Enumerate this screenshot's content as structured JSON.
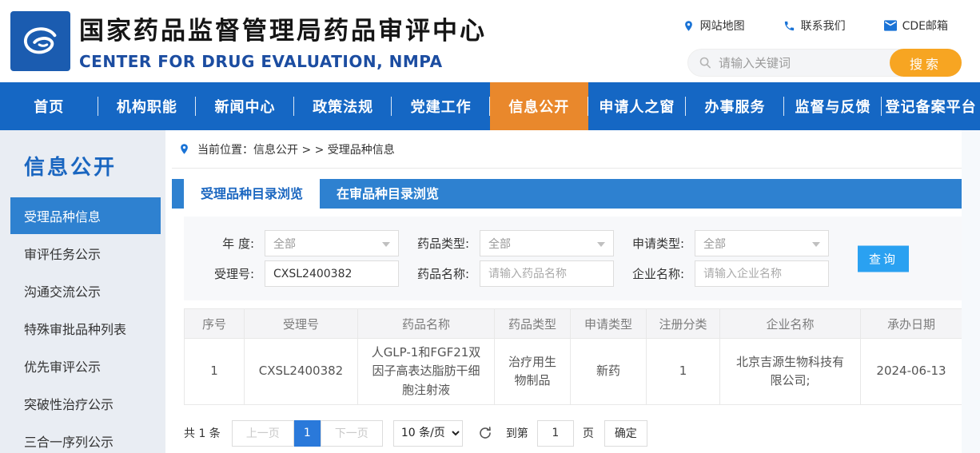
{
  "palette": {
    "nav_blue": "#1567c4",
    "tab_blue": "#2e81d0",
    "active_orange": "#e9882c",
    "search_button_orange": "#f7a522",
    "query_button_blue": "#2aa1f1",
    "pagination_active_blue": "#2a79da",
    "sidebar_bg": "#e9edf3",
    "subtitle_blue": "#1c4da1"
  },
  "header": {
    "title": "国家药品监督管理局药品审评中心",
    "subtitle": "CENTER FOR DRUG EVALUATION, NMPA",
    "quick_links": [
      {
        "label": "网站地图",
        "icon": "location-pin-icon"
      },
      {
        "label": "联系我们",
        "icon": "phone-icon"
      },
      {
        "label": "CDE邮箱",
        "icon": "envelope-icon"
      }
    ],
    "search": {
      "placeholder": "请输入关键词",
      "button": "搜索"
    }
  },
  "nav": {
    "items": [
      {
        "label": "首页"
      },
      {
        "label": "机构职能"
      },
      {
        "label": "新闻中心"
      },
      {
        "label": "政策法规"
      },
      {
        "label": "党建工作"
      },
      {
        "label": "信息公开",
        "active": true
      },
      {
        "label": "申请人之窗"
      },
      {
        "label": "办事服务"
      },
      {
        "label": "监督与反馈"
      },
      {
        "label": "登记备案平台"
      }
    ]
  },
  "sidebar": {
    "title": "信息公开",
    "items": [
      {
        "label": "受理品种信息",
        "active": true
      },
      {
        "label": "审评任务公示"
      },
      {
        "label": "沟通交流公示"
      },
      {
        "label": "特殊审批品种列表"
      },
      {
        "label": "优先审评公示"
      },
      {
        "label": "突破性治疗公示"
      },
      {
        "label": "三合一序列公示"
      }
    ]
  },
  "main": {
    "breadcrumb": "当前位置：信息公开 > > 受理品种信息",
    "tabs": [
      {
        "label": "受理品种目录浏览",
        "active": true
      },
      {
        "label": "在审品种目录浏览",
        "active": false
      }
    ],
    "filter": {
      "year_label": "年 度:",
      "year_value": "全部",
      "drug_type_label": "药品类型:",
      "drug_type_value": "全部",
      "apply_type_label": "申请类型:",
      "apply_type_value": "全部",
      "acceptance_label": "受理号:",
      "acceptance_value": "CXSL2400382",
      "drug_name_label": "药品名称:",
      "drug_name_placeholder": "请输入药品名称",
      "company_label": "企业名称:",
      "company_placeholder": "请输入企业名称",
      "query_button": "查询"
    },
    "table": {
      "headers": [
        "序号",
        "受理号",
        "药品名称",
        "药品类型",
        "申请类型",
        "注册分类",
        "企业名称",
        "承办日期"
      ],
      "rows": [
        [
          "1",
          "CXSL2400382",
          "人GLP-1和FGF21双因子高表达脂肪干细胞注射液",
          "治疗用生物制品",
          "新药",
          "1",
          "北京吉源生物科技有限公司;",
          "2024-06-13"
        ]
      ]
    },
    "pagination": {
      "total": "共 1 条",
      "prev": "上一页",
      "page": "1",
      "next": "下一页",
      "page_size": "10 条/页",
      "goto_label": "到第",
      "goto_value": "1",
      "goto_unit": "页",
      "confirm": "确定"
    }
  }
}
